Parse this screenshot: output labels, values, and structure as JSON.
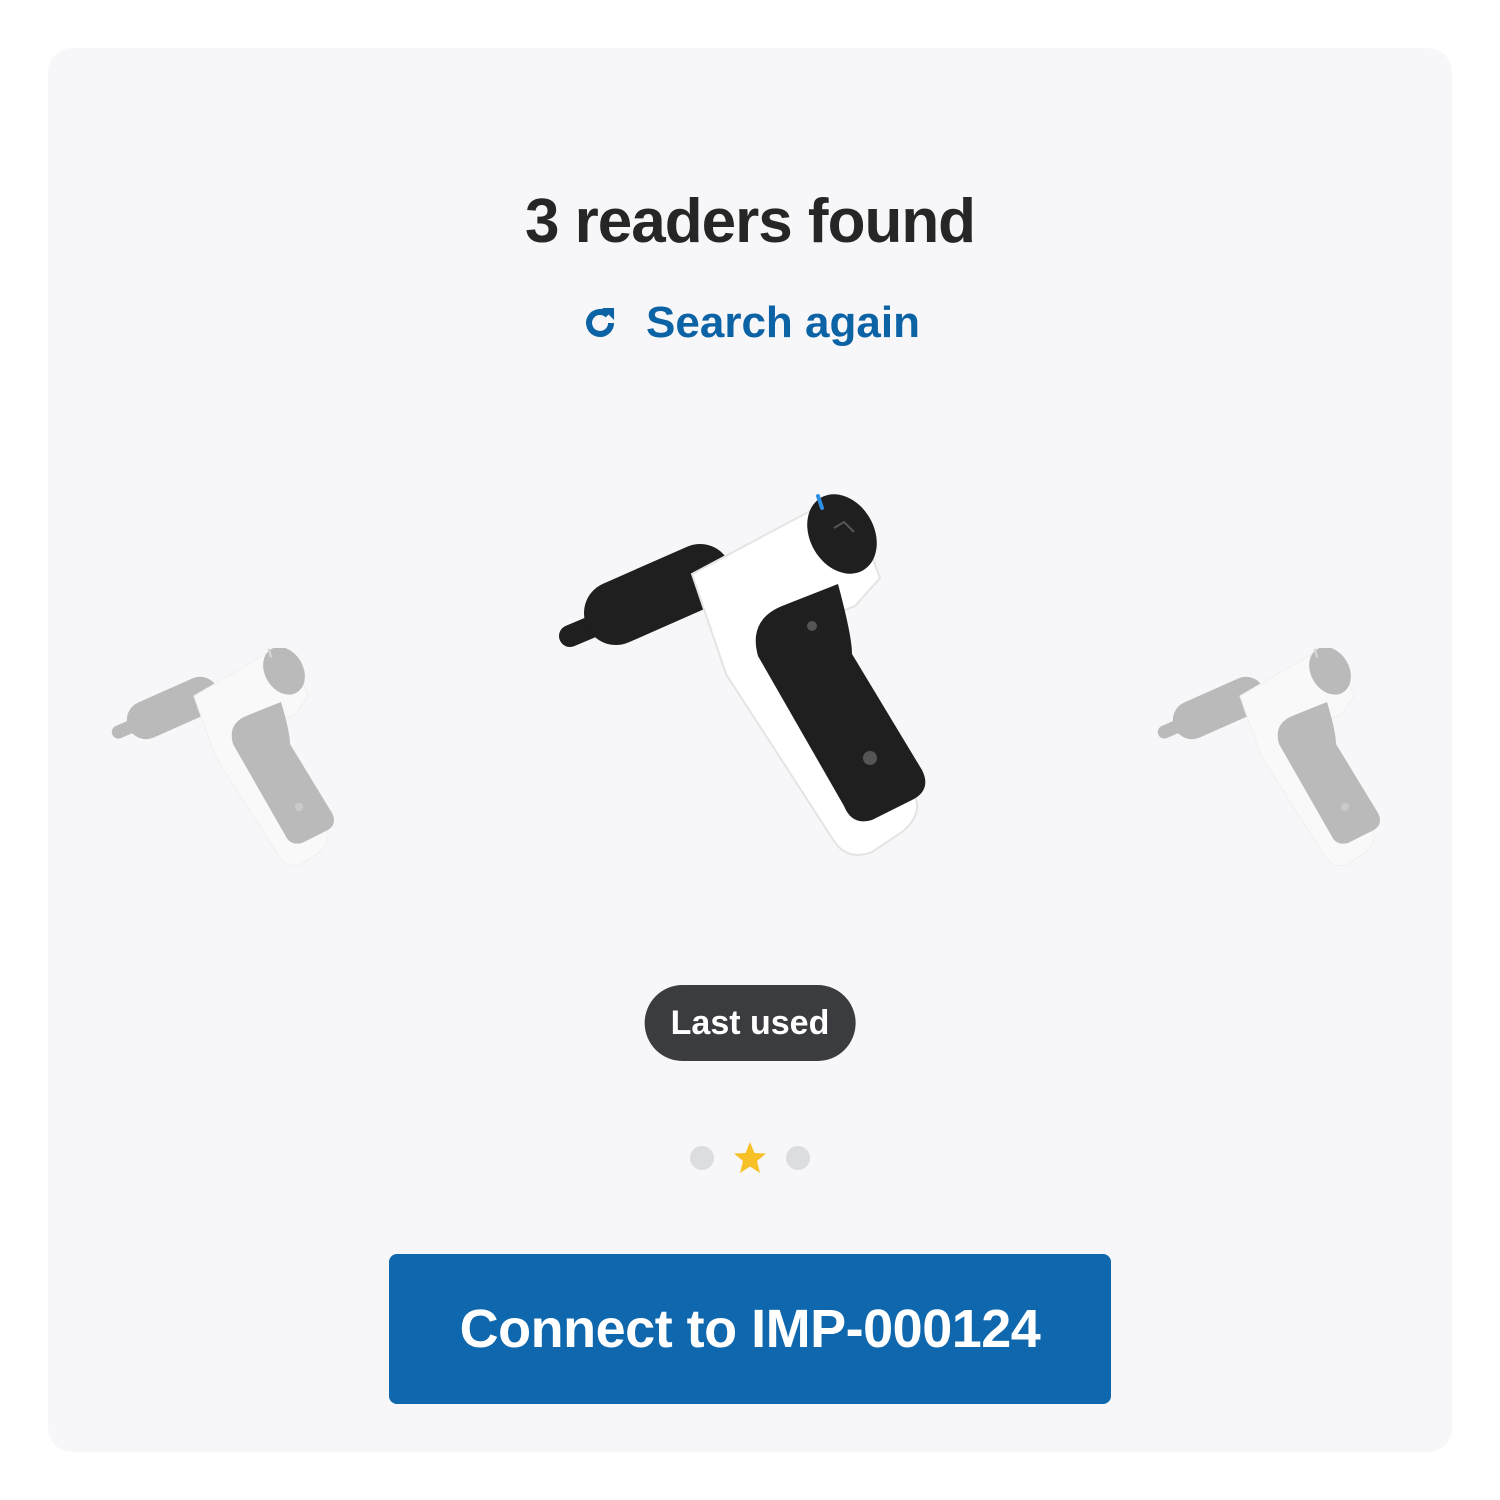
{
  "header": {
    "title": "3 readers found"
  },
  "search": {
    "label": "Search again",
    "icon": "refresh-icon"
  },
  "carousel": {
    "readers": [
      {
        "position": "previous",
        "icon": "card-reader-icon"
      },
      {
        "position": "current",
        "icon": "card-reader-icon"
      },
      {
        "position": "next",
        "icon": "card-reader-icon"
      }
    ],
    "badge": "Last used",
    "page_count": 3,
    "selected_index": 1
  },
  "connect": {
    "label": "Connect to IMP-000124"
  },
  "colors": {
    "accent": "#0f68ad",
    "link": "#0b62a4",
    "badge_bg": "#3b3c40",
    "star": "#f6c026",
    "card_bg": "#f7f7f9"
  }
}
